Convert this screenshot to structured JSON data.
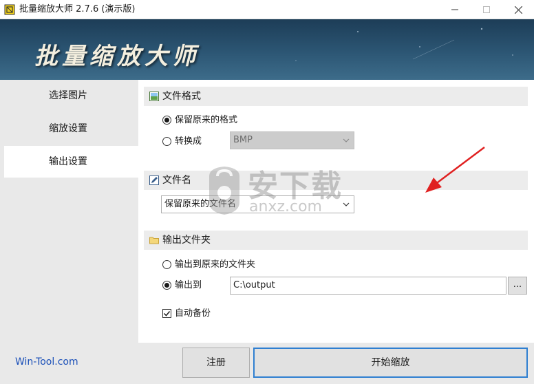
{
  "window": {
    "title": "批量缩放大师 2.7.6 (演示版)",
    "banner_text": "批量缩放大师"
  },
  "sidebar": {
    "items": [
      {
        "label": "选择图片",
        "active": false
      },
      {
        "label": "缩放设置",
        "active": false
      },
      {
        "label": "输出设置",
        "active": true
      }
    ]
  },
  "file_format": {
    "title": "文件格式",
    "keep_label": "保留原来的格式",
    "convert_label": "转换成",
    "convert_value": "BMP",
    "selected": "keep"
  },
  "file_name": {
    "title": "文件名",
    "value": "保留原来的文件名"
  },
  "output_folder": {
    "title": "输出文件夹",
    "original_label": "输出到原来的文件夹",
    "output_to_label": "输出到",
    "path": "C:\\output",
    "browse_label": "...",
    "selected": "output_to",
    "backup_label": "自动备份",
    "backup_checked": true
  },
  "footer": {
    "site": "Win-Tool.com",
    "register_label": "注册",
    "start_label": "开始缩放"
  },
  "watermark": {
    "text_cn": "安下载",
    "text_en": "anxz.com"
  },
  "colors": {
    "accent": "#2f7fd1",
    "link": "#1a4fb8",
    "banner": "#2c5674",
    "arrow": "#e02020"
  }
}
